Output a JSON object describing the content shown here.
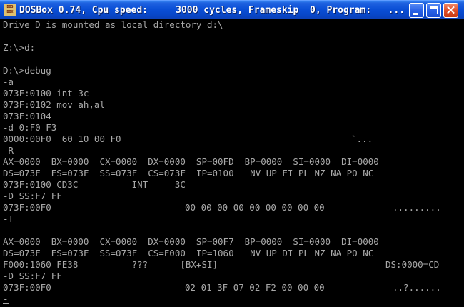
{
  "window": {
    "title": "DOSBox 0.74, Cpu speed:     3000 cycles, Frameskip  0, Program:   ...",
    "icon_text": "DOS BOX"
  },
  "console": {
    "lines": [
      "Drive D is mounted as local directory d:\\",
      "",
      "Z:\\>d:",
      "",
      "D:\\>debug",
      "-a",
      "073F:0100 int 3c",
      "073F:0102 mov ah,al",
      "073F:0104",
      "-d 0:F0 F3",
      "0000:00F0  60 10 00 F0",
      "-R",
      "AX=0000  BX=0000  CX=0000  DX=0000  SP=00FD  BP=0000  SI=0000  DI=0000",
      "DS=073F  ES=073F  SS=073F  CS=073F  IP=0100   NV UP EI PL NZ NA PO NC",
      "073F:0100 CD3C          INT     3C",
      "-D SS:F7 FF",
      "073F:00F0",
      "-T",
      "",
      "AX=0000  BX=0000  CX=0000  DX=0000  SP=00F7  BP=0000  SI=0000  DI=0000",
      "DS=073F  ES=073F  SS=073F  CS=F000  IP=1060   NV UP DI PL NZ NA PO NC",
      "F000:1060 FE38          ???      [BX+SI]",
      "-D SS:F7 FF",
      "073F:00F0",
      "-"
    ],
    "ascii_dump_1": "`...",
    "dump_1_hex": "00-00 00 00 00 00 00 00 00",
    "dump_1_ascii": ".........",
    "segment_note": "DS:0000=CD",
    "dump_2_hex": "02-01 3F 07 02 F2 00 00 00",
    "dump_2_ascii": "..?......"
  }
}
